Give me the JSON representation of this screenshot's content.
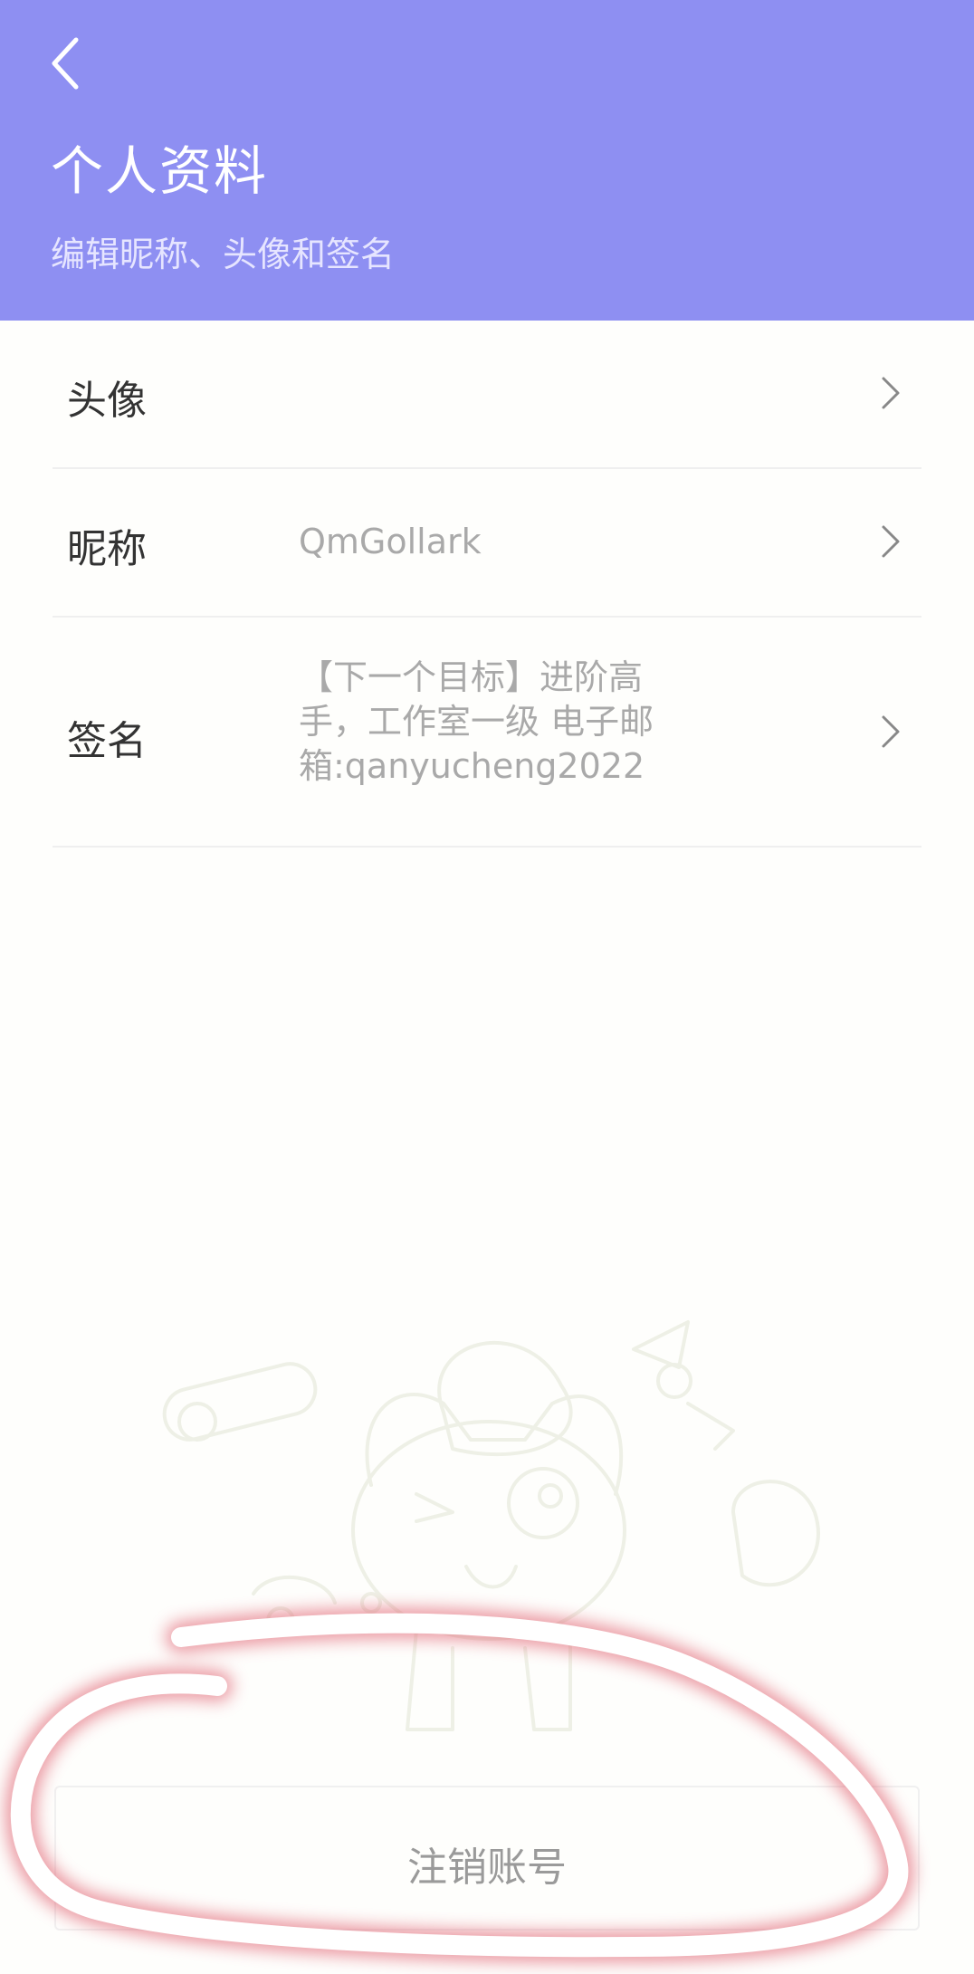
{
  "header": {
    "back_icon": "chevron-left-icon",
    "title": "个人资料",
    "subtitle": "编辑昵称、头像和签名",
    "background_color": "#8e8ff2"
  },
  "profile": {
    "avatar": {
      "label": "头像",
      "icon": "chevron-right-icon"
    },
    "nickname": {
      "label": "昵称",
      "value": "QmGollark",
      "icon": "chevron-right-icon"
    },
    "signature": {
      "label": "签名",
      "lines": [
        "【下一个目标】进阶高",
        "手，工作室一级  电子邮",
        "箱:qanyucheng2022"
      ],
      "icon": "chevron-right-icon"
    }
  },
  "footer": {
    "logout_label": "注销账号"
  },
  "annotation": {
    "type": "hand-drawn-circle",
    "stroke_color": "#ffffff",
    "glow_color": "#e06070"
  }
}
